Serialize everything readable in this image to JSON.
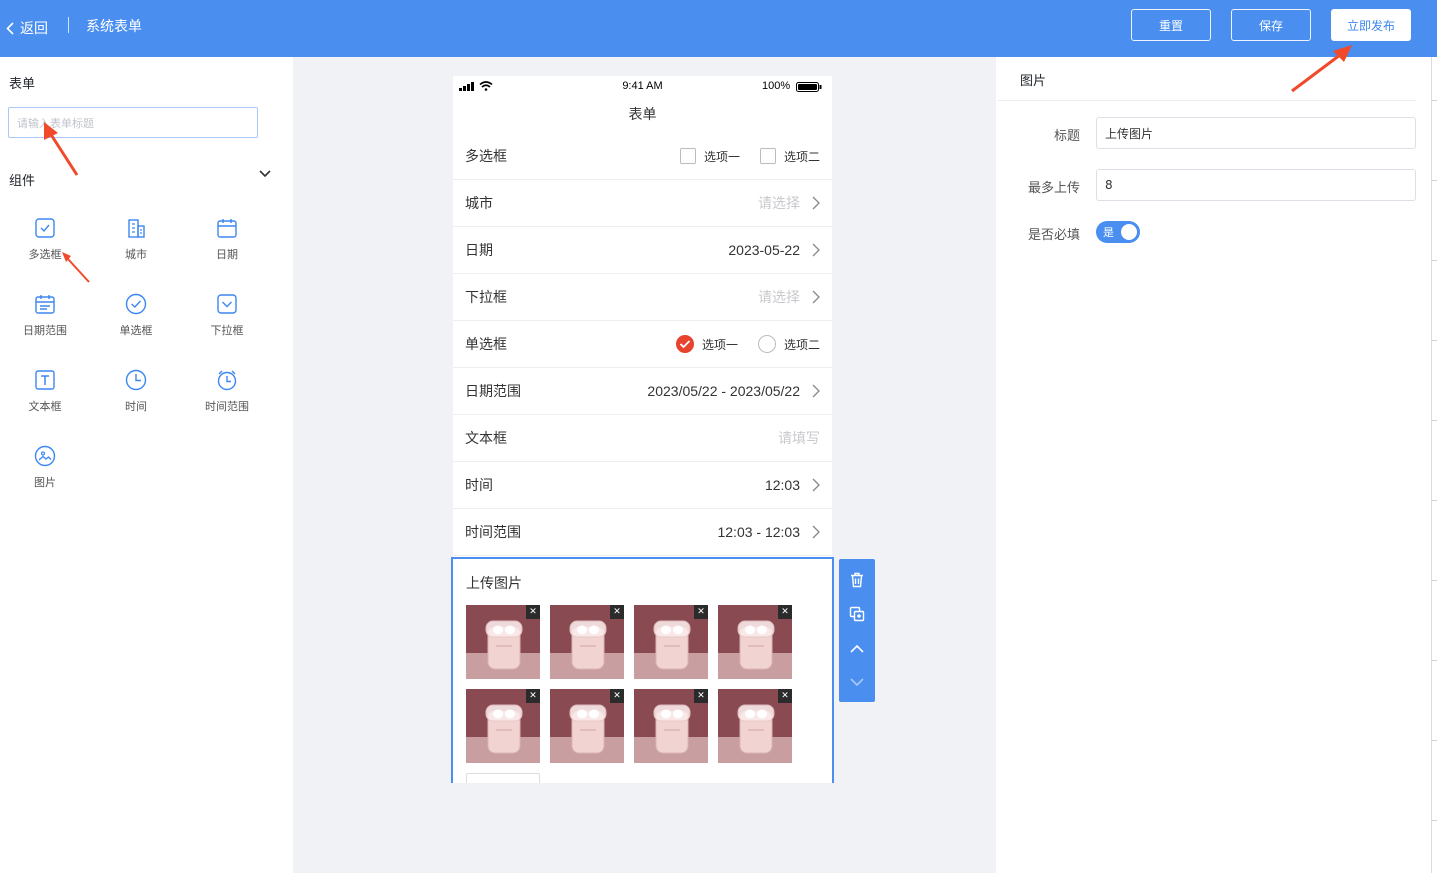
{
  "header": {
    "back_label": "返回",
    "title": "系统表单",
    "buttons": {
      "reset": "重置",
      "save": "保存",
      "publish": "立即发布"
    }
  },
  "left_panel": {
    "form_label": "表单",
    "title_placeholder": "请输入表单标题",
    "components_label": "组件",
    "components": [
      {
        "label": "多选框",
        "icon": "checkbox-icon"
      },
      {
        "label": "城市",
        "icon": "city-icon"
      },
      {
        "label": "日期",
        "icon": "calendar-icon"
      },
      {
        "label": "日期范围",
        "icon": "date-range-icon"
      },
      {
        "label": "单选框",
        "icon": "radio-icon"
      },
      {
        "label": "下拉框",
        "icon": "dropdown-icon"
      },
      {
        "label": "文本框",
        "icon": "text-icon"
      },
      {
        "label": "时间",
        "icon": "clock-icon"
      },
      {
        "label": "时间范围",
        "icon": "alarm-icon"
      },
      {
        "label": "图片",
        "icon": "image-icon"
      }
    ]
  },
  "phone": {
    "status": {
      "time": "9:41 AM",
      "battery": "100%"
    },
    "title": "表单",
    "rows": [
      {
        "label": "多选框",
        "type": "checkbox",
        "options": [
          "选项一",
          "选项二"
        ]
      },
      {
        "label": "城市",
        "type": "select",
        "placeholder": "请选择"
      },
      {
        "label": "日期",
        "type": "select",
        "value": "2023-05-22"
      },
      {
        "label": "下拉框",
        "type": "select",
        "placeholder": "请选择"
      },
      {
        "label": "单选框",
        "type": "radio",
        "options": [
          "选项一",
          "选项二"
        ],
        "selected": 0
      },
      {
        "label": "日期范围",
        "type": "select",
        "value": "2023/05/22 - 2023/05/22"
      },
      {
        "label": "文本框",
        "type": "text",
        "placeholder": "请填写"
      },
      {
        "label": "时间",
        "type": "select",
        "value": "12:03"
      },
      {
        "label": "时间范围",
        "type": "select",
        "value": "12:03 - 12:03"
      }
    ],
    "upload": {
      "label": "上传图片",
      "image_count": 8
    }
  },
  "toolbar": {
    "tools": [
      "trash-icon",
      "copy-icon",
      "move-up-icon",
      "move-down-icon"
    ]
  },
  "right_panel": {
    "section_title": "图片",
    "fields": {
      "title_label": "标题",
      "title_value": "上传图片",
      "max_label": "最多上传",
      "max_value": "8",
      "required_label": "是否必填",
      "required_value": "是"
    }
  },
  "colors": {
    "brand": "#4a8ff0",
    "radio_selected": "#e8432f",
    "annotation": "#f04a2a"
  }
}
